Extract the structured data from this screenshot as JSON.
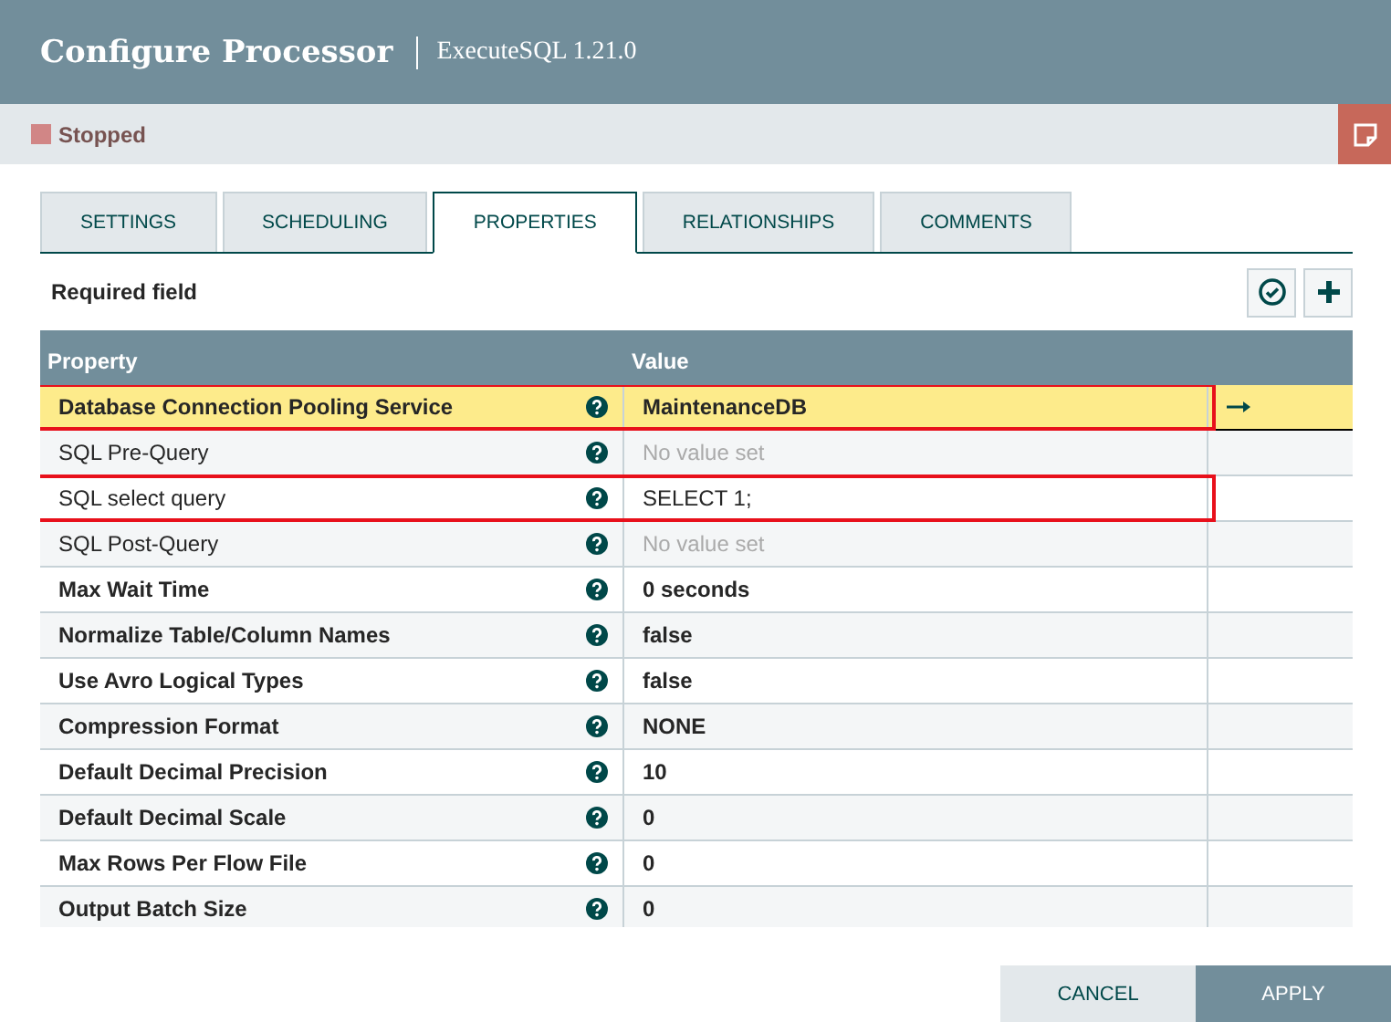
{
  "window": {
    "title": "Configure Processor",
    "subtitle": "ExecuteSQL 1.21.0"
  },
  "status": {
    "label": "Stopped",
    "running": false
  },
  "tabs": [
    {
      "label": "SETTINGS",
      "selected": false
    },
    {
      "label": "SCHEDULING",
      "selected": false
    },
    {
      "label": "PROPERTIES",
      "selected": true
    },
    {
      "label": "RELATIONSHIPS",
      "selected": false
    },
    {
      "label": "COMMENTS",
      "selected": false
    }
  ],
  "required_note": "Required field",
  "table": {
    "columns": [
      "Property",
      "Value"
    ],
    "rows": [
      {
        "name": "Database Connection Pooling Service",
        "required": true,
        "value": "MaintenanceDB",
        "value_set": true,
        "selected": true,
        "highlighted": true,
        "goto": true
      },
      {
        "name": "SQL Pre-Query",
        "required": false,
        "value": "No value set",
        "value_set": false,
        "selected": false,
        "highlighted": false,
        "goto": false
      },
      {
        "name": "SQL select query",
        "required": false,
        "value": "SELECT 1;",
        "value_set": true,
        "selected": false,
        "highlighted": true,
        "goto": false
      },
      {
        "name": "SQL Post-Query",
        "required": false,
        "value": "No value set",
        "value_set": false,
        "selected": false,
        "highlighted": false,
        "goto": false
      },
      {
        "name": "Max Wait Time",
        "required": true,
        "value": "0 seconds",
        "value_set": true,
        "selected": false,
        "highlighted": false,
        "goto": false
      },
      {
        "name": "Normalize Table/Column Names",
        "required": true,
        "value": "false",
        "value_set": true,
        "selected": false,
        "highlighted": false,
        "goto": false
      },
      {
        "name": "Use Avro Logical Types",
        "required": true,
        "value": "false",
        "value_set": true,
        "selected": false,
        "highlighted": false,
        "goto": false
      },
      {
        "name": "Compression Format",
        "required": true,
        "value": "NONE",
        "value_set": true,
        "selected": false,
        "highlighted": false,
        "goto": false
      },
      {
        "name": "Default Decimal Precision",
        "required": true,
        "value": "10",
        "value_set": true,
        "selected": false,
        "highlighted": false,
        "goto": false
      },
      {
        "name": "Default Decimal Scale",
        "required": true,
        "value": "0",
        "value_set": true,
        "selected": false,
        "highlighted": false,
        "goto": false
      },
      {
        "name": "Max Rows Per Flow File",
        "required": true,
        "value": "0",
        "value_set": true,
        "selected": false,
        "highlighted": false,
        "goto": false
      },
      {
        "name": "Output Batch Size",
        "required": true,
        "value": "0",
        "value_set": true,
        "selected": false,
        "highlighted": false,
        "goto": false
      }
    ]
  },
  "buttons": [
    {
      "label": "CANCEL",
      "kind": "secondary"
    },
    {
      "label": "APPLY",
      "kind": "primary"
    }
  ]
}
